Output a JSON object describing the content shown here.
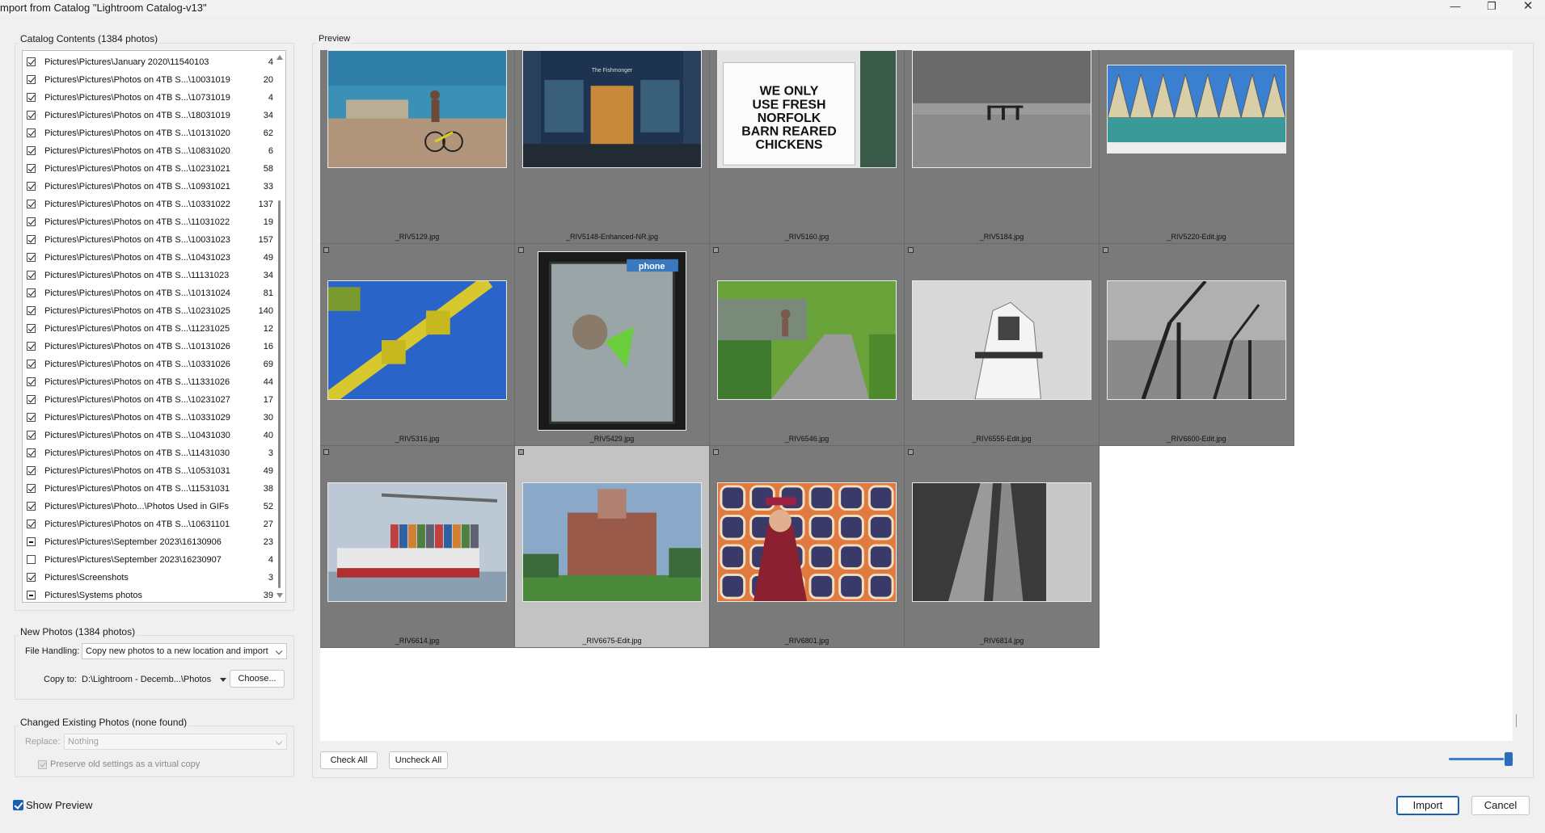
{
  "window": {
    "title": "mport from Catalog \"Lightroom Catalog-v13\"",
    "minimize_glyph": "—",
    "maximize_glyph": "❐",
    "close_glyph": "✕"
  },
  "catalog_contents": {
    "title": "Catalog Contents (1384 photos)",
    "items": [
      {
        "path": "Pictures\\Pictures\\January 2020\\11540103",
        "count": "4",
        "state": "checked"
      },
      {
        "path": "Pictures\\Pictures\\Photos on 4TB S...\\10031019",
        "count": "20",
        "state": "checked"
      },
      {
        "path": "Pictures\\Pictures\\Photos on 4TB S...\\10731019",
        "count": "4",
        "state": "checked"
      },
      {
        "path": "Pictures\\Pictures\\Photos on 4TB S...\\18031019",
        "count": "34",
        "state": "checked"
      },
      {
        "path": "Pictures\\Pictures\\Photos on 4TB S...\\10131020",
        "count": "62",
        "state": "checked"
      },
      {
        "path": "Pictures\\Pictures\\Photos on 4TB S...\\10831020",
        "count": "6",
        "state": "checked"
      },
      {
        "path": "Pictures\\Pictures\\Photos on 4TB S...\\10231021",
        "count": "58",
        "state": "checked"
      },
      {
        "path": "Pictures\\Pictures\\Photos on 4TB S...\\10931021",
        "count": "33",
        "state": "checked"
      },
      {
        "path": "Pictures\\Pictures\\Photos on 4TB S...\\10331022",
        "count": "137",
        "state": "checked"
      },
      {
        "path": "Pictures\\Pictures\\Photos on 4TB S...\\11031022",
        "count": "19",
        "state": "checked"
      },
      {
        "path": "Pictures\\Pictures\\Photos on 4TB S...\\10031023",
        "count": "157",
        "state": "checked"
      },
      {
        "path": "Pictures\\Pictures\\Photos on 4TB S...\\10431023",
        "count": "49",
        "state": "checked"
      },
      {
        "path": "Pictures\\Pictures\\Photos on 4TB S...\\11131023",
        "count": "34",
        "state": "checked"
      },
      {
        "path": "Pictures\\Pictures\\Photos on 4TB S...\\10131024",
        "count": "81",
        "state": "checked"
      },
      {
        "path": "Pictures\\Pictures\\Photos on 4TB S...\\10231025",
        "count": "140",
        "state": "checked"
      },
      {
        "path": "Pictures\\Pictures\\Photos on 4TB S...\\11231025",
        "count": "12",
        "state": "checked"
      },
      {
        "path": "Pictures\\Pictures\\Photos on 4TB S...\\10131026",
        "count": "16",
        "state": "checked"
      },
      {
        "path": "Pictures\\Pictures\\Photos on 4TB S...\\10331026",
        "count": "69",
        "state": "checked"
      },
      {
        "path": "Pictures\\Pictures\\Photos on 4TB S...\\11331026",
        "count": "44",
        "state": "checked"
      },
      {
        "path": "Pictures\\Pictures\\Photos on 4TB S...\\10231027",
        "count": "17",
        "state": "checked"
      },
      {
        "path": "Pictures\\Pictures\\Photos on 4TB S...\\10331029",
        "count": "30",
        "state": "checked"
      },
      {
        "path": "Pictures\\Pictures\\Photos on 4TB S...\\10431030",
        "count": "40",
        "state": "checked"
      },
      {
        "path": "Pictures\\Pictures\\Photos on 4TB S...\\11431030",
        "count": "3",
        "state": "checked"
      },
      {
        "path": "Pictures\\Pictures\\Photos on 4TB S...\\10531031",
        "count": "49",
        "state": "checked"
      },
      {
        "path": "Pictures\\Pictures\\Photos on 4TB S...\\11531031",
        "count": "38",
        "state": "checked"
      },
      {
        "path": "Pictures\\Pictures\\Photo...\\Photos Used in GIFs",
        "count": "52",
        "state": "checked"
      },
      {
        "path": "Pictures\\Pictures\\Photos on 4TB S...\\10631101",
        "count": "27",
        "state": "checked"
      },
      {
        "path": "Pictures\\Pictures\\September 2023\\16130906",
        "count": "23",
        "state": "partial"
      },
      {
        "path": "Pictures\\Pictures\\September 2023\\16230907",
        "count": "4",
        "state": "unchecked"
      },
      {
        "path": "Pictures\\Screenshots",
        "count": "3",
        "state": "checked"
      },
      {
        "path": "Pictures\\Systems photos",
        "count": "39",
        "state": "partial"
      }
    ]
  },
  "new_photos": {
    "title": "New Photos (1384 photos)",
    "file_handling_label": "File Handling:",
    "file_handling_value": "Copy new photos to a new location and import",
    "copy_to_label": "Copy to:",
    "copy_to_value": "D:\\Lightroom - Decemb...\\Photos",
    "choose_label": "Choose..."
  },
  "changed_existing": {
    "title": "Changed Existing Photos (none found)",
    "replace_label": "Replace:",
    "replace_value": "Nothing",
    "preserve_label": "Preserve old settings as a virtual copy"
  },
  "show_preview_label": "Show Preview",
  "preview": {
    "title": "Preview",
    "check_all_label": "Check All",
    "uncheck_all_label": "Uncheck All",
    "thumbnail_size": 0.85,
    "thumbs": [
      {
        "name": "_RIV5129.jpg",
        "scene": "beach-cyclist"
      },
      {
        "name": "_RIV5148-Enhanced-NR.jpg",
        "scene": "shopfront-night"
      },
      {
        "name": "_RIV5160.jpg",
        "scene": "sign"
      },
      {
        "name": "_RIV5184.jpg",
        "scene": "bw-pier"
      },
      {
        "name": "_RIV5220-Edit.jpg",
        "scene": "pavilion-roof"
      },
      {
        "name": "_RIV5316.jpg",
        "scene": "fair-ride"
      },
      {
        "name": "_RIV5429.jpg",
        "scene": "phone-booth"
      },
      {
        "name": "_RIV6546.jpg",
        "scene": "park-path"
      },
      {
        "name": "_RIV6555-Edit.jpg",
        "scene": "bw-prayer-shawl"
      },
      {
        "name": "_RIV6600-Edit.jpg",
        "scene": "bw-cranes"
      },
      {
        "name": "_RIV6614.jpg",
        "scene": "container-ship"
      },
      {
        "name": "_RIV6675-Edit.jpg",
        "scene": "hotel-building"
      },
      {
        "name": "_RIV6801.jpg",
        "scene": "retro-wall-portrait"
      },
      {
        "name": "_RIV6814.jpg",
        "scene": "escalators"
      }
    ],
    "sign_lines": [
      "WE ONLY",
      "USE FRESH",
      "NORFOLK",
      "BARN REARED",
      "CHICKENS"
    ],
    "phone_text": "phone",
    "shop_sign_text": "The Fishmonger"
  },
  "buttons": {
    "import_label": "Import",
    "cancel_label": "Cancel"
  },
  "colors": {
    "accent": "#1a5fb4",
    "cell_bg": "#7a7a7a",
    "cell_selected_bg": "#c3c3c3"
  }
}
